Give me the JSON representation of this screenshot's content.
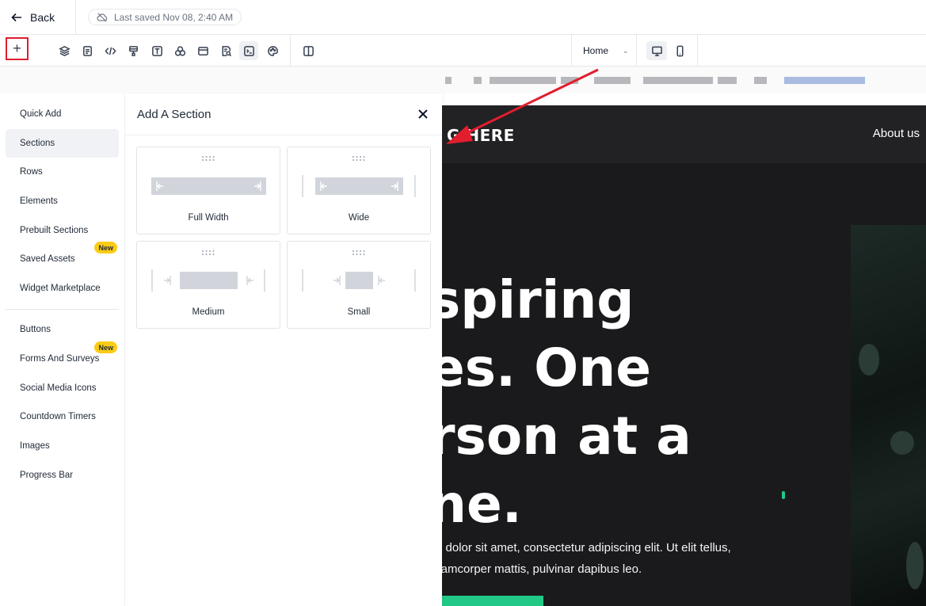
{
  "topbar": {
    "back_label": "Back",
    "saved_text": "Last saved Nov 08, 2:40 AM"
  },
  "toolbar": {
    "add_label": "+",
    "page_select": "Home",
    "tools": [
      "layers-icon",
      "page-icon",
      "code-icon",
      "paint-icon",
      "text-icon",
      "shapes-icon",
      "browser-icon",
      "search-doc-icon",
      "terminal-icon",
      "palette-icon",
      "columns-icon"
    ]
  },
  "left_nav": {
    "items": [
      {
        "label": "Quick Add"
      },
      {
        "label": "Sections",
        "active": true
      },
      {
        "label": "Rows"
      },
      {
        "label": "Elements"
      },
      {
        "label": "Prebuilt Sections"
      },
      {
        "label": "Saved Assets",
        "badge": "New"
      },
      {
        "label": "Widget Marketplace"
      },
      {
        "label": "Buttons"
      },
      {
        "label": "Forms And Surveys",
        "badge": "New"
      },
      {
        "label": "Social Media Icons"
      },
      {
        "label": "Countdown Timers"
      },
      {
        "label": "Images"
      },
      {
        "label": "Progress Bar"
      }
    ]
  },
  "panel": {
    "title": "Add A Section",
    "cards": [
      {
        "label": "Full Width"
      },
      {
        "label": "Wide"
      },
      {
        "label": "Medium"
      },
      {
        "label": "Small"
      }
    ]
  },
  "site": {
    "logo": "G HERE",
    "nav_link": "About us",
    "hero_title": "spiring\nes. One\nrson at a\nne.",
    "hero_text_line1": "n dolor sit amet, consectetur adipiscing elit. Ut elit tellus,",
    "hero_text_line2": "llamcorper mattis, pulvinar dapibus leo."
  },
  "colors": {
    "accent_red": "#e11d2e",
    "badge_yellow": "#facc15",
    "site_bg": "#1a1a1c",
    "cta_green": "#22c986"
  }
}
